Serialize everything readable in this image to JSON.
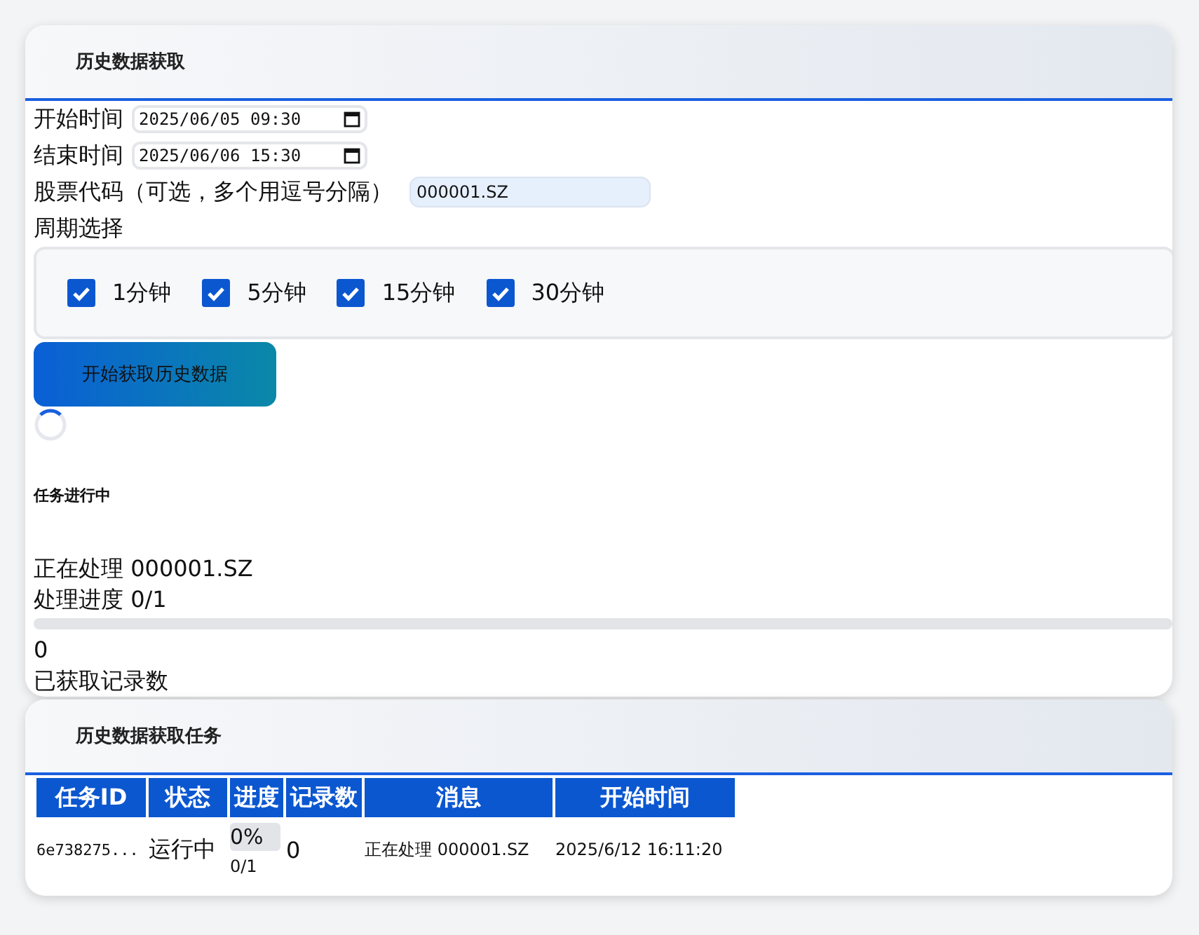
{
  "fetch_panel": {
    "title": "历史数据获取",
    "start_time": {
      "label": "开始时间",
      "value": "2025/06/05 09:30"
    },
    "end_time": {
      "label": "结束时间",
      "value": "2025/06/06 15:30"
    },
    "stock_code": {
      "label": "股票代码（可选，多个用逗号分隔）",
      "value": "000001.SZ"
    },
    "period": {
      "label": "周期选择",
      "options": [
        {
          "label": "1分钟",
          "checked": true
        },
        {
          "label": "5分钟",
          "checked": true
        },
        {
          "label": "15分钟",
          "checked": true
        },
        {
          "label": "30分钟",
          "checked": true
        }
      ]
    },
    "start_button": "开始获取历史数据",
    "loading": true,
    "status": {
      "heading": "任务进行中",
      "message": "正在处理 000001.SZ",
      "progress_text": "处理进度 0/1",
      "level": 0,
      "record_count": "0",
      "record_label": "已获取记录数"
    }
  },
  "tasks_panel": {
    "title": "历史数据获取任务",
    "columns": [
      "任务ID",
      "状态",
      "进度",
      "记录数",
      "消息",
      "开始时间"
    ],
    "rows": [
      {
        "id": "6e738275...",
        "status": "运行中",
        "progress": "0%",
        "progress_count": "0/1",
        "level": 0,
        "records": "0",
        "message": "正在处理 000001.SZ",
        "start_time": "2025/6/12 16:11:20"
      }
    ]
  }
}
